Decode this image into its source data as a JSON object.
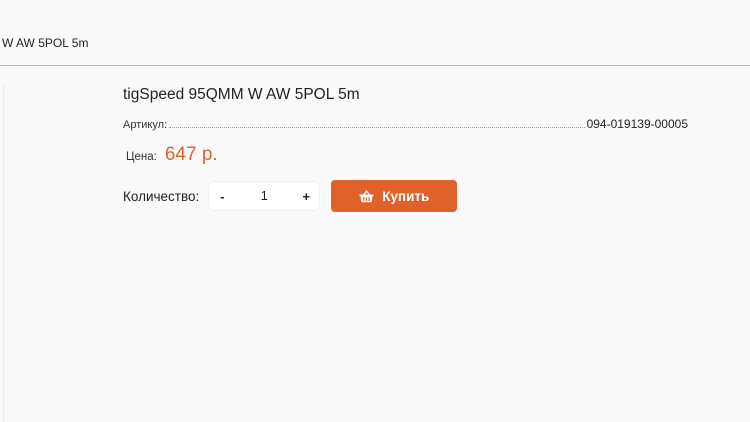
{
  "breadcrumb": {
    "current": "W AW 5POL 5m"
  },
  "product": {
    "title": "tigSpeed 95QMM W AW 5POL 5m",
    "sku_label": "Артикул:",
    "sku_value": "094-019139-00005",
    "price_label": "Цена:",
    "price_value": "647 р.",
    "quantity_label": "Количество:",
    "quantity_minus": "-",
    "quantity_value": "1",
    "quantity_plus": "+",
    "buy_label": "Купить",
    "buy_icon": "basket-icon"
  },
  "colors": {
    "accent": "#e0622b",
    "divider": "#bdbdbd",
    "background": "#fafafa"
  }
}
